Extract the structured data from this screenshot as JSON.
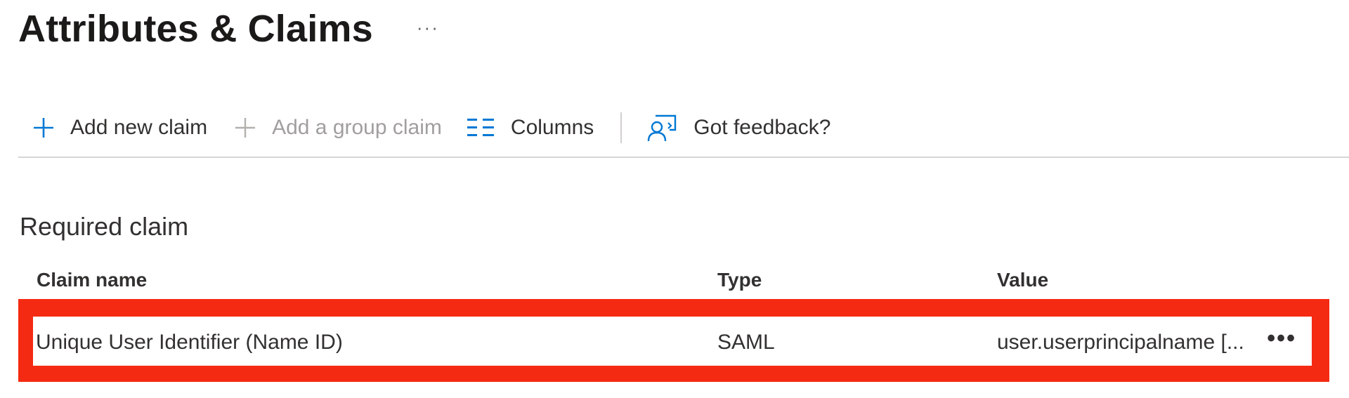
{
  "header": {
    "title": "Attributes & Claims",
    "more_label": "···"
  },
  "toolbar": {
    "add_claim_label": "Add new claim",
    "add_group_claim_label": "Add a group claim",
    "columns_label": "Columns",
    "feedback_label": "Got feedback?",
    "accent_color": "#0078d4",
    "disabled_color": "#a19f9d"
  },
  "section": {
    "title": "Required claim"
  },
  "table": {
    "columns": [
      "Claim name",
      "Type",
      "Value"
    ],
    "rows": [
      {
        "claim_name": "Unique User Identifier (Name ID)",
        "type": "SAML",
        "value": "user.userprincipalname [...",
        "more_label": "•••"
      }
    ],
    "highlight_color": "#f52a12"
  }
}
